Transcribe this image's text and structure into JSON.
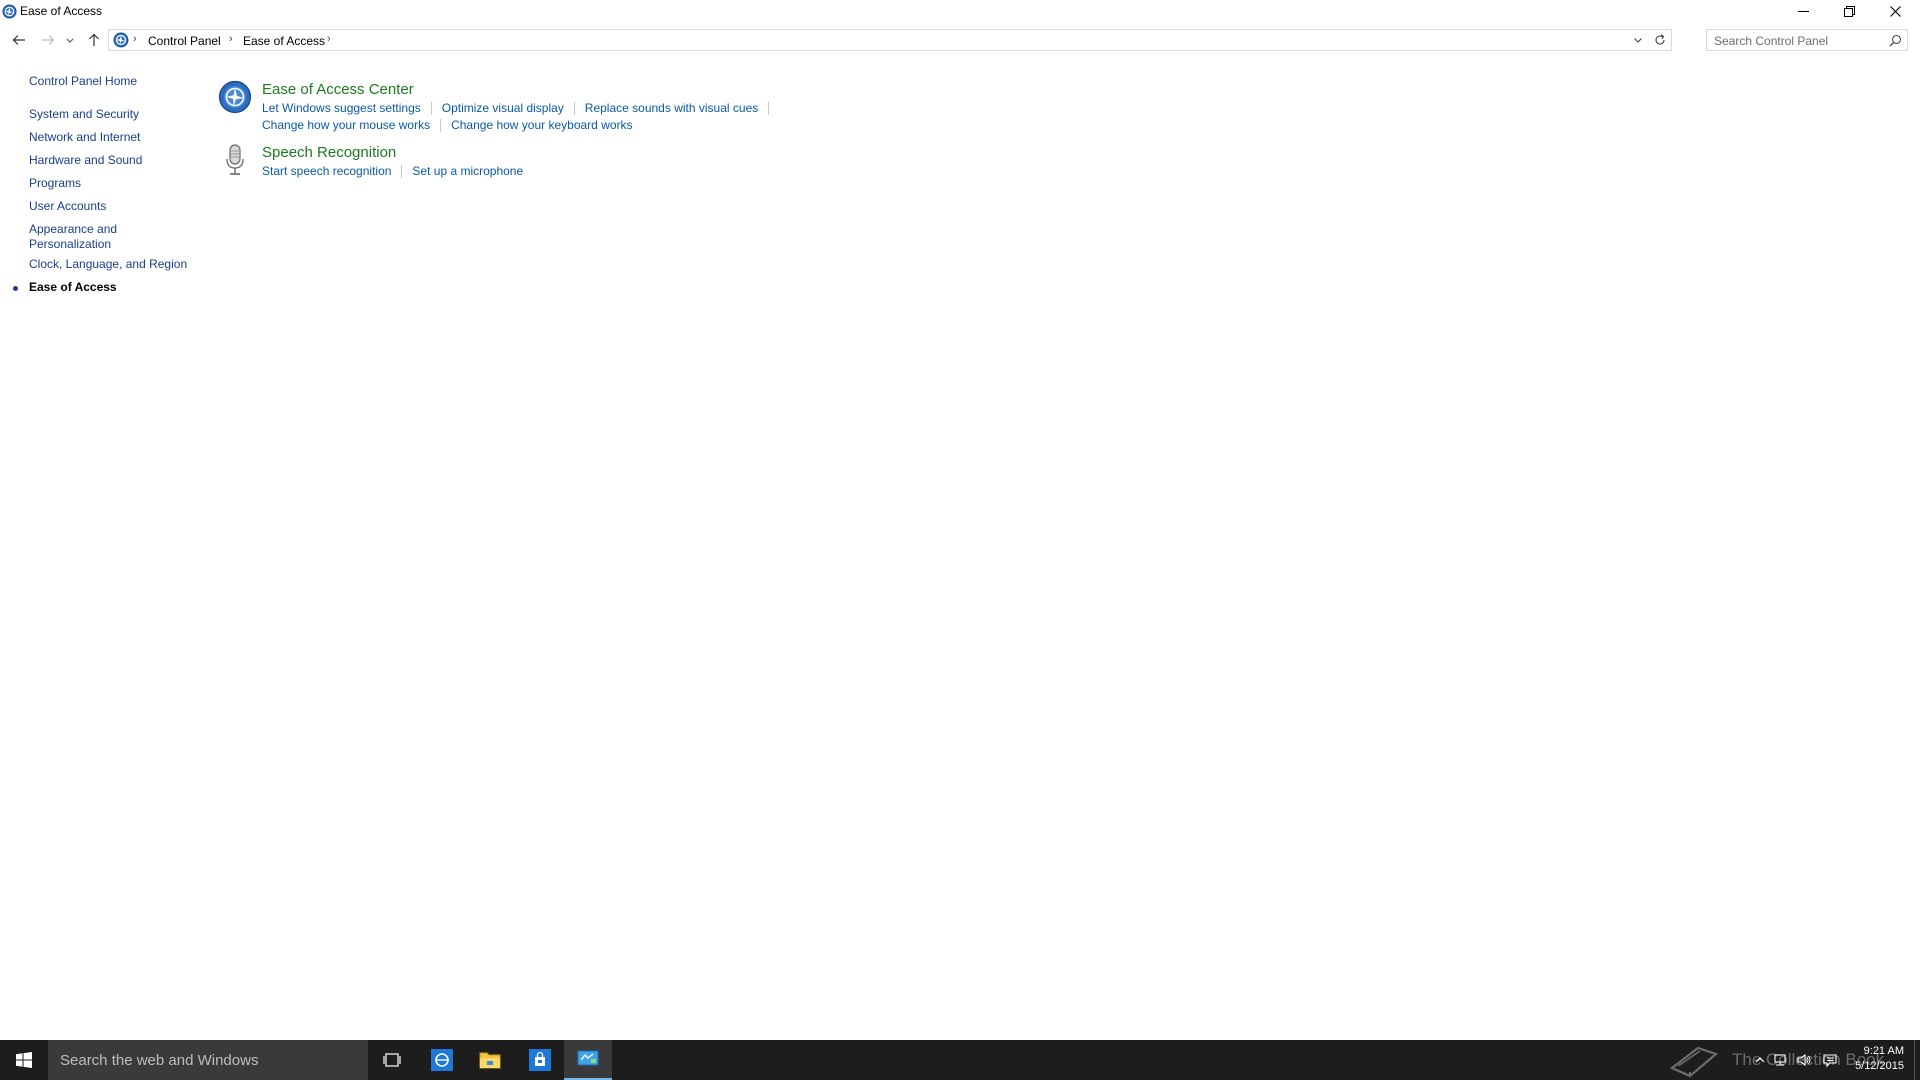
{
  "window": {
    "title": "Ease of Access"
  },
  "address_bar": {
    "breadcrumbs": [
      "Control Panel",
      "Ease of Access"
    ],
    "search_placeholder": "Search Control Panel"
  },
  "left_nav": {
    "home": "Control Panel Home",
    "items": [
      "System and Security",
      "Network and Internet",
      "Hardware and Sound",
      "Programs",
      "User Accounts",
      "Appearance and",
      "Personalization",
      "Clock, Language, and Region",
      "Ease of Access"
    ]
  },
  "categories": [
    {
      "title": "Ease of Access Center",
      "links_row1": [
        "Let Windows suggest settings",
        "Optimize visual display",
        "Replace sounds with visual cues"
      ],
      "links_row2": [
        "Change how your mouse works",
        "Change how your keyboard works"
      ]
    },
    {
      "title": "Speech Recognition",
      "links_row1": [
        "Start speech recognition",
        "Set up a microphone"
      ]
    }
  ],
  "taskbar": {
    "search_text": "Search the web and Windows",
    "time": "9:21 AM",
    "date": "5/12/2015",
    "watermark_text": "The Collection Book"
  },
  "colors": {
    "link": "#0a5aaa",
    "category_title": "#1e7a1e",
    "nav_link": "#1a3e8c",
    "taskbar": "#1d1d1d"
  }
}
